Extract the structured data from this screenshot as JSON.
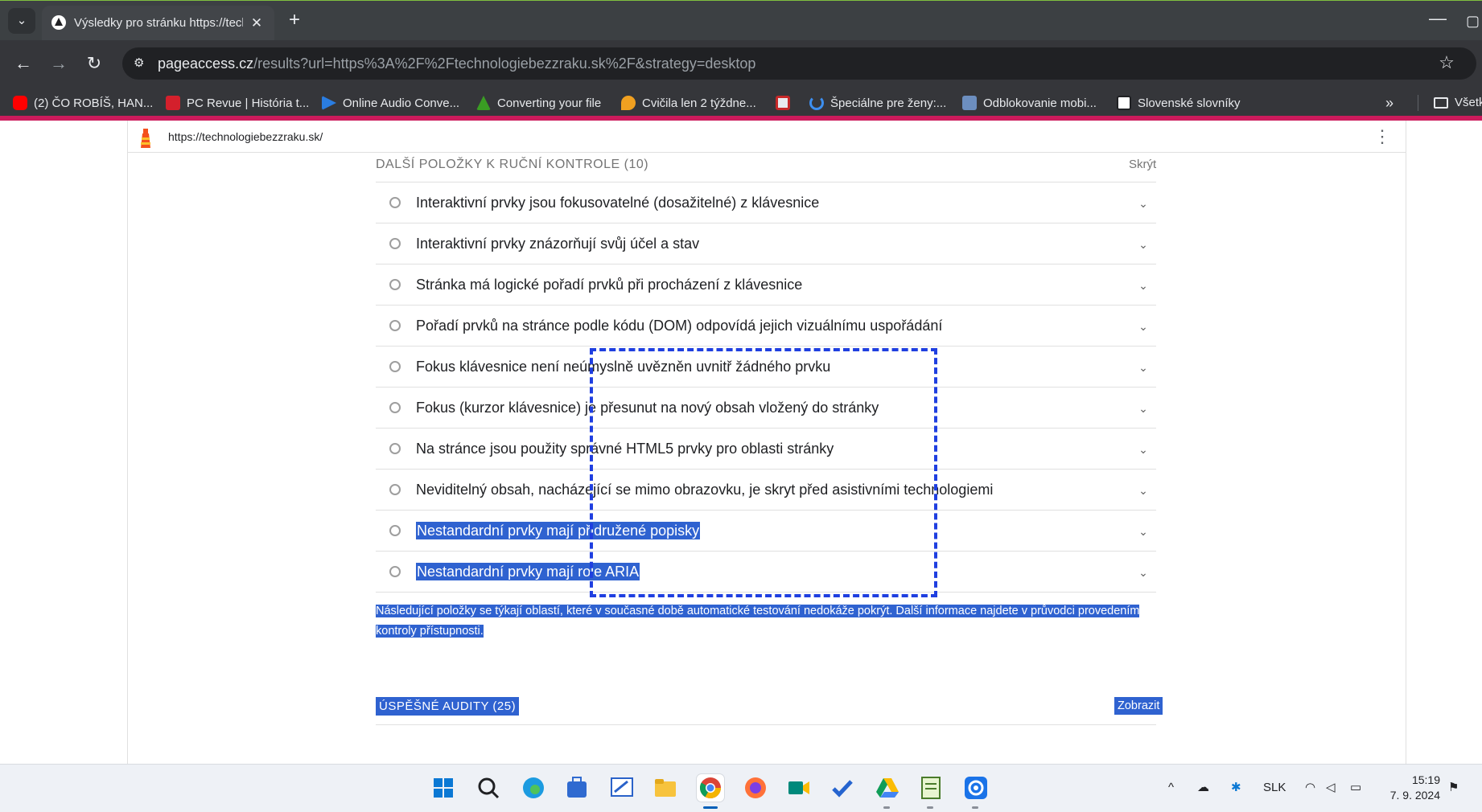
{
  "browser": {
    "tab": {
      "title": "Výsledky pro stránku https://technologiebezzraku.sk/",
      "close_glyph": "✕"
    },
    "new_tab_glyph": "+",
    "controls": {
      "minimize_glyph": "—",
      "maximize_glyph": "▢"
    },
    "nav": {
      "back_glyph": "←",
      "forward_glyph": "→",
      "reload_glyph": "↻"
    },
    "url": {
      "host": "pageaccess.cz",
      "path": "/results?url=https%3A%2F%2Ftechnologiebezzraku.sk%2F&strategy=desktop"
    },
    "star_glyph": "☆",
    "bookmarks": [
      {
        "label": "(2) ČO ROBÍŠ, HAN...",
        "icon": "youtube-icon",
        "color": "#ff0000"
      },
      {
        "label": "PC Revue | História t...",
        "icon": "pcrevue-icon",
        "color": "#d4202c"
      },
      {
        "label": "Online Audio Conve...",
        "icon": "play-icon",
        "color": "#2a7de1"
      },
      {
        "label": "Converting your file",
        "icon": "converter-icon",
        "color": "#3a9d23"
      },
      {
        "label": "Cvičila len 2 týždne...",
        "icon": "pin-icon",
        "color": "#f0a020"
      },
      {
        "label": "",
        "icon": "red-app-icon",
        "color": "#e8eaed"
      },
      {
        "label": "Špeciálne pre ženy:...",
        "icon": "hook-icon",
        "color": "#3d8ff0"
      },
      {
        "label": "Odblokovanie mobi...",
        "icon": "pc-icon",
        "color": "#6c8ebf"
      },
      {
        "label": "Slovenské slovníky",
        "icon": "dictionary-icon",
        "color": "#ffffff"
      }
    ],
    "bookmarks_more_glyph": "»",
    "all_bookmarks_label": "Všetky"
  },
  "report": {
    "url": "https://technologiebezzraku.sk/",
    "menu_glyph": "⋮",
    "manual_section": {
      "title": "DALŠÍ POLOŽKY K RUČNÍ KONTROLE (10)",
      "toggle": "Skrýt",
      "items": [
        {
          "label": "Interaktivní prvky jsou fokusovatelné (dosažitelné) z klávesnice",
          "selected": false
        },
        {
          "label": "Interaktivní prvky znázorňují svůj účel a stav",
          "selected": false
        },
        {
          "label": "Stránka má logické pořadí prvků při procházení z klávesnice",
          "selected": false
        },
        {
          "label": "Pořadí prvků na stránce podle kódu (DOM) odpovídá jejich vizuálnímu uspořádání",
          "selected": false
        },
        {
          "label": "Fokus klávesnice není neúmyslně uvězněn uvnitř žádného prvku",
          "selected": false
        },
        {
          "label": "Fokus (kurzor klávesnice) je přesunut na nový obsah vložený do stránky",
          "selected": false
        },
        {
          "label": "Na stránce jsou použity správné HTML5 prvky pro oblasti stránky",
          "selected": false
        },
        {
          "label": "Neviditelný obsah, nacházející se mimo obrazovku, je skryt před asistivními technologiemi",
          "selected": false
        },
        {
          "label": "Nestandardní prvky mají přidružené popisky",
          "selected": true
        },
        {
          "label": "Nestandardní prvky mají role ARIA",
          "selected": true
        }
      ],
      "chevron_glyph": "⌄",
      "note": "Následující položky se týkají oblastí, které v současné době automatické testování nedokáže pokrýt. Další informace najdete v průvodci provedením kontroly přístupnosti."
    },
    "passed_section": {
      "title": "ÚSPĚŠNÉ AUDITY (25)",
      "toggle": "Zobrazit"
    }
  },
  "taskbar": {
    "apps": [
      {
        "icon": "windows-start-icon"
      },
      {
        "icon": "search-icon"
      },
      {
        "icon": "edge-icon"
      },
      {
        "icon": "store-icon"
      },
      {
        "icon": "whiteboard-icon"
      },
      {
        "icon": "file-explorer-icon"
      },
      {
        "icon": "chrome-icon"
      },
      {
        "icon": "firefox-icon"
      },
      {
        "icon": "meet-icon"
      },
      {
        "icon": "todo-icon"
      },
      {
        "icon": "google-drive-icon"
      },
      {
        "icon": "notepad-icon"
      },
      {
        "icon": "settings-icon"
      }
    ],
    "tray": {
      "chevron_glyph": "^",
      "language": "SLK",
      "time": "15:19",
      "date": "7. 9. 2024"
    }
  },
  "colors": {
    "selection": "#2f62d0",
    "focus_box": "#1f3fe0",
    "accent_line": "#cc1b5c"
  }
}
